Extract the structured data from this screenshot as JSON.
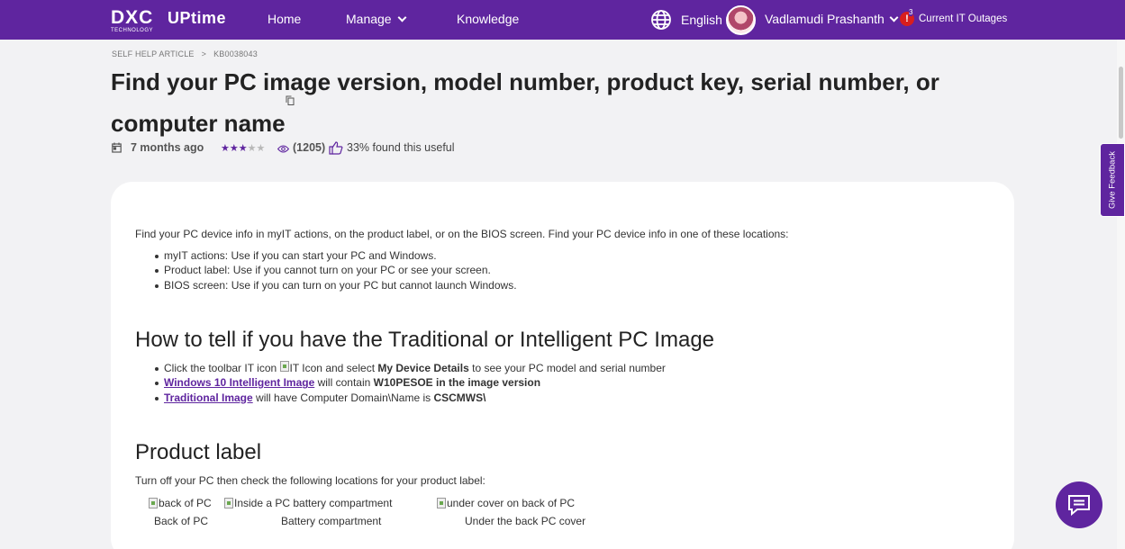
{
  "header": {
    "logo_main": "DXC",
    "logo_sub": "TECHNOLOGY",
    "product": "UPtime",
    "nav": {
      "home": "Home",
      "manage": "Manage",
      "knowledge": "Knowledge"
    },
    "language": "English",
    "user_name": "Vadlamudi Prashanth",
    "alert_symbol": "!",
    "alert_count": "3",
    "outages_label": "Current IT Outages"
  },
  "breadcrumb": {
    "section": "SELF HELP ARTICLE",
    "separator": ">",
    "article_id": "KB0038043"
  },
  "article": {
    "title_line1": "Find your PC image version, model number, product key, serial number, or",
    "title_line2": "computer name",
    "age": "7 months ago",
    "rating": {
      "filled": "★★★",
      "empty": "★★",
      "value": 3,
      "max": 5
    },
    "views": "(1205)",
    "useful": "33% found this useful",
    "intro": "Find your PC device info in myIT actions, on the product label, or on the BIOS screen. Find your PC device info in one of these locations:",
    "locations": [
      "myIT actions: Use if you can start your PC and Windows.",
      "Product label: Use if you cannot turn on your PC or see your screen.",
      "BIOS screen: Use if you can turn on your PC but cannot launch Windows."
    ],
    "section1_heading": "How to tell if you have the Traditional or Intelligent PC Image",
    "section1": {
      "item1_prefix": "Click the toolbar IT icon",
      "item1_img_alt": "IT Icon",
      "item1_mid": "and select",
      "item1_bold": "My Device Details",
      "item1_suffix": "to see your PC model and serial number",
      "item2_link": "Windows 10 Intelligent Image",
      "item2_text": "will contain",
      "item2_bold": "W10PESOE in the image version",
      "item3_link": "Traditional Image",
      "item3_text": "will have Computer Domain\\Name is",
      "item3_bold": "CSCMWS\\"
    },
    "section2_heading": "Product label",
    "section2_intro": "Turn off your PC then check the following locations for your product label:",
    "images": [
      {
        "alt": "back of PC",
        "caption": "Back of PC"
      },
      {
        "alt": "Inside a PC battery compartment",
        "caption": "Battery compartment"
      },
      {
        "alt": "under cover on back of PC",
        "caption": "Under the back PC cover"
      }
    ]
  },
  "feedback_label": "Give Feedback",
  "colors": {
    "brand": "#5f259f",
    "alert": "#d81e1e",
    "background": "#f2f2f4"
  }
}
